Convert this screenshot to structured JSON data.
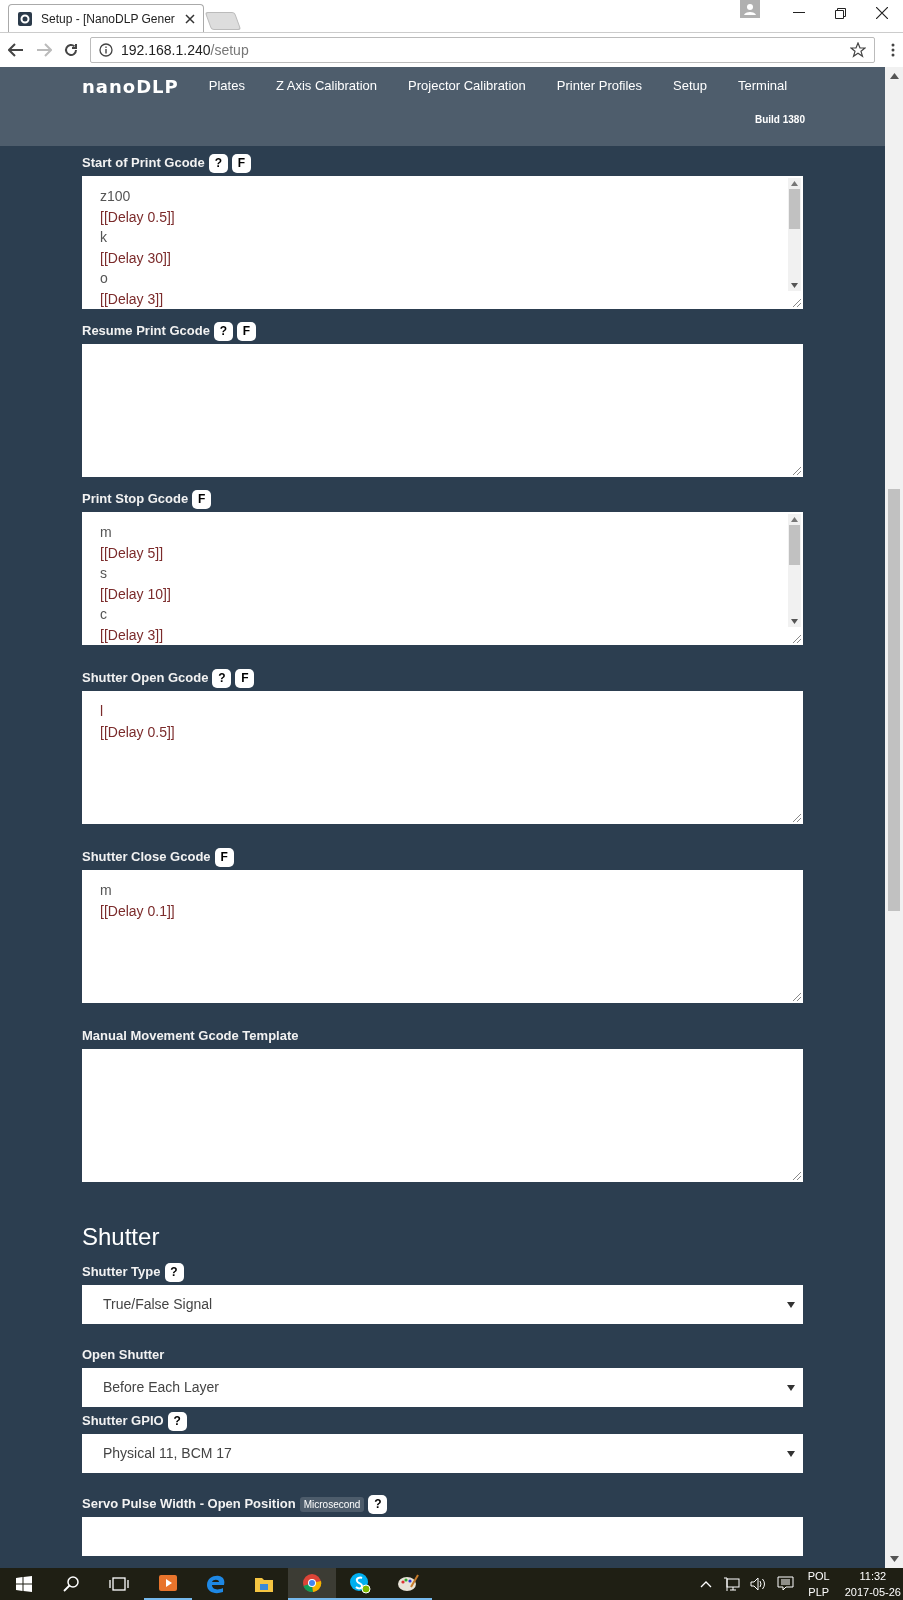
{
  "browser": {
    "tab_title": "Setup - [NanoDLP Gener",
    "url_host": "192.168.1.240",
    "url_path": "/setup"
  },
  "nav": {
    "logo": "nanoDLP",
    "items": [
      "Plates",
      "Z Axis Calibration",
      "Projector Calibration",
      "Printer Profiles",
      "Setup",
      "Terminal"
    ],
    "build": "Build 1380"
  },
  "gcode_fields": [
    {
      "label": "Start of Print Gcode",
      "badges": [
        "?",
        "F"
      ],
      "scrollbar": true,
      "lines": [
        {
          "text": "z100",
          "kind": "plain"
        },
        {
          "text": "[[Delay 0.5]]",
          "kind": "macro"
        },
        {
          "text": "k",
          "kind": "plain"
        },
        {
          "text": "[[Delay 30]]",
          "kind": "macro"
        },
        {
          "text": "o",
          "kind": "plain"
        },
        {
          "text": "[[Delay 3]]",
          "kind": "macro"
        }
      ]
    },
    {
      "label": "Resume Print Gcode",
      "badges": [
        "?",
        "F"
      ],
      "scrollbar": false
    },
    {
      "label": "Print Stop Gcode",
      "badges": [
        "F"
      ],
      "scrollbar": true,
      "lines": [
        {
          "text": "m",
          "kind": "plain"
        },
        {
          "text": "[[Delay 5]]",
          "kind": "macro"
        },
        {
          "text": "s",
          "kind": "plain"
        },
        {
          "text": "[[Delay 10]]",
          "kind": "macro"
        },
        {
          "text": "c",
          "kind": "plain"
        },
        {
          "text": "[[Delay 3]]",
          "kind": "macro"
        }
      ]
    },
    {
      "label": "Shutter Open Gcode",
      "badges": [
        "?",
        "F"
      ],
      "scrollbar": false,
      "lines": [
        {
          "text": "l",
          "kind": "macro"
        },
        {
          "text": "[[Delay 0.5]]",
          "kind": "macro"
        }
      ]
    },
    {
      "label": "Shutter Close Gcode",
      "badges": [
        "F"
      ],
      "scrollbar": false,
      "lines": [
        {
          "text": "m",
          "kind": "plain"
        },
        {
          "text": "[[Delay 0.1]]",
          "kind": "macro"
        }
      ]
    },
    {
      "label": "Manual Movement Gcode Template",
      "scrollbar": false
    }
  ],
  "section_title": "Shutter",
  "selects": [
    {
      "label": "Shutter Type",
      "badges": [
        "?"
      ],
      "value": "True/False Signal"
    },
    {
      "label": "Open Shutter",
      "value": "Before Each Layer"
    },
    {
      "label": "Shutter GPIO",
      "badges": [
        "?"
      ],
      "value": "Physical 11, BCM 17"
    }
  ],
  "servo": {
    "label": "Servo Pulse Width - Open Position",
    "unit": "Microsecond",
    "badges": [
      "?"
    ]
  },
  "taskbar": {
    "language": "POL",
    "layout": "PLP",
    "time": "11:32",
    "date": "2017-05-26"
  }
}
